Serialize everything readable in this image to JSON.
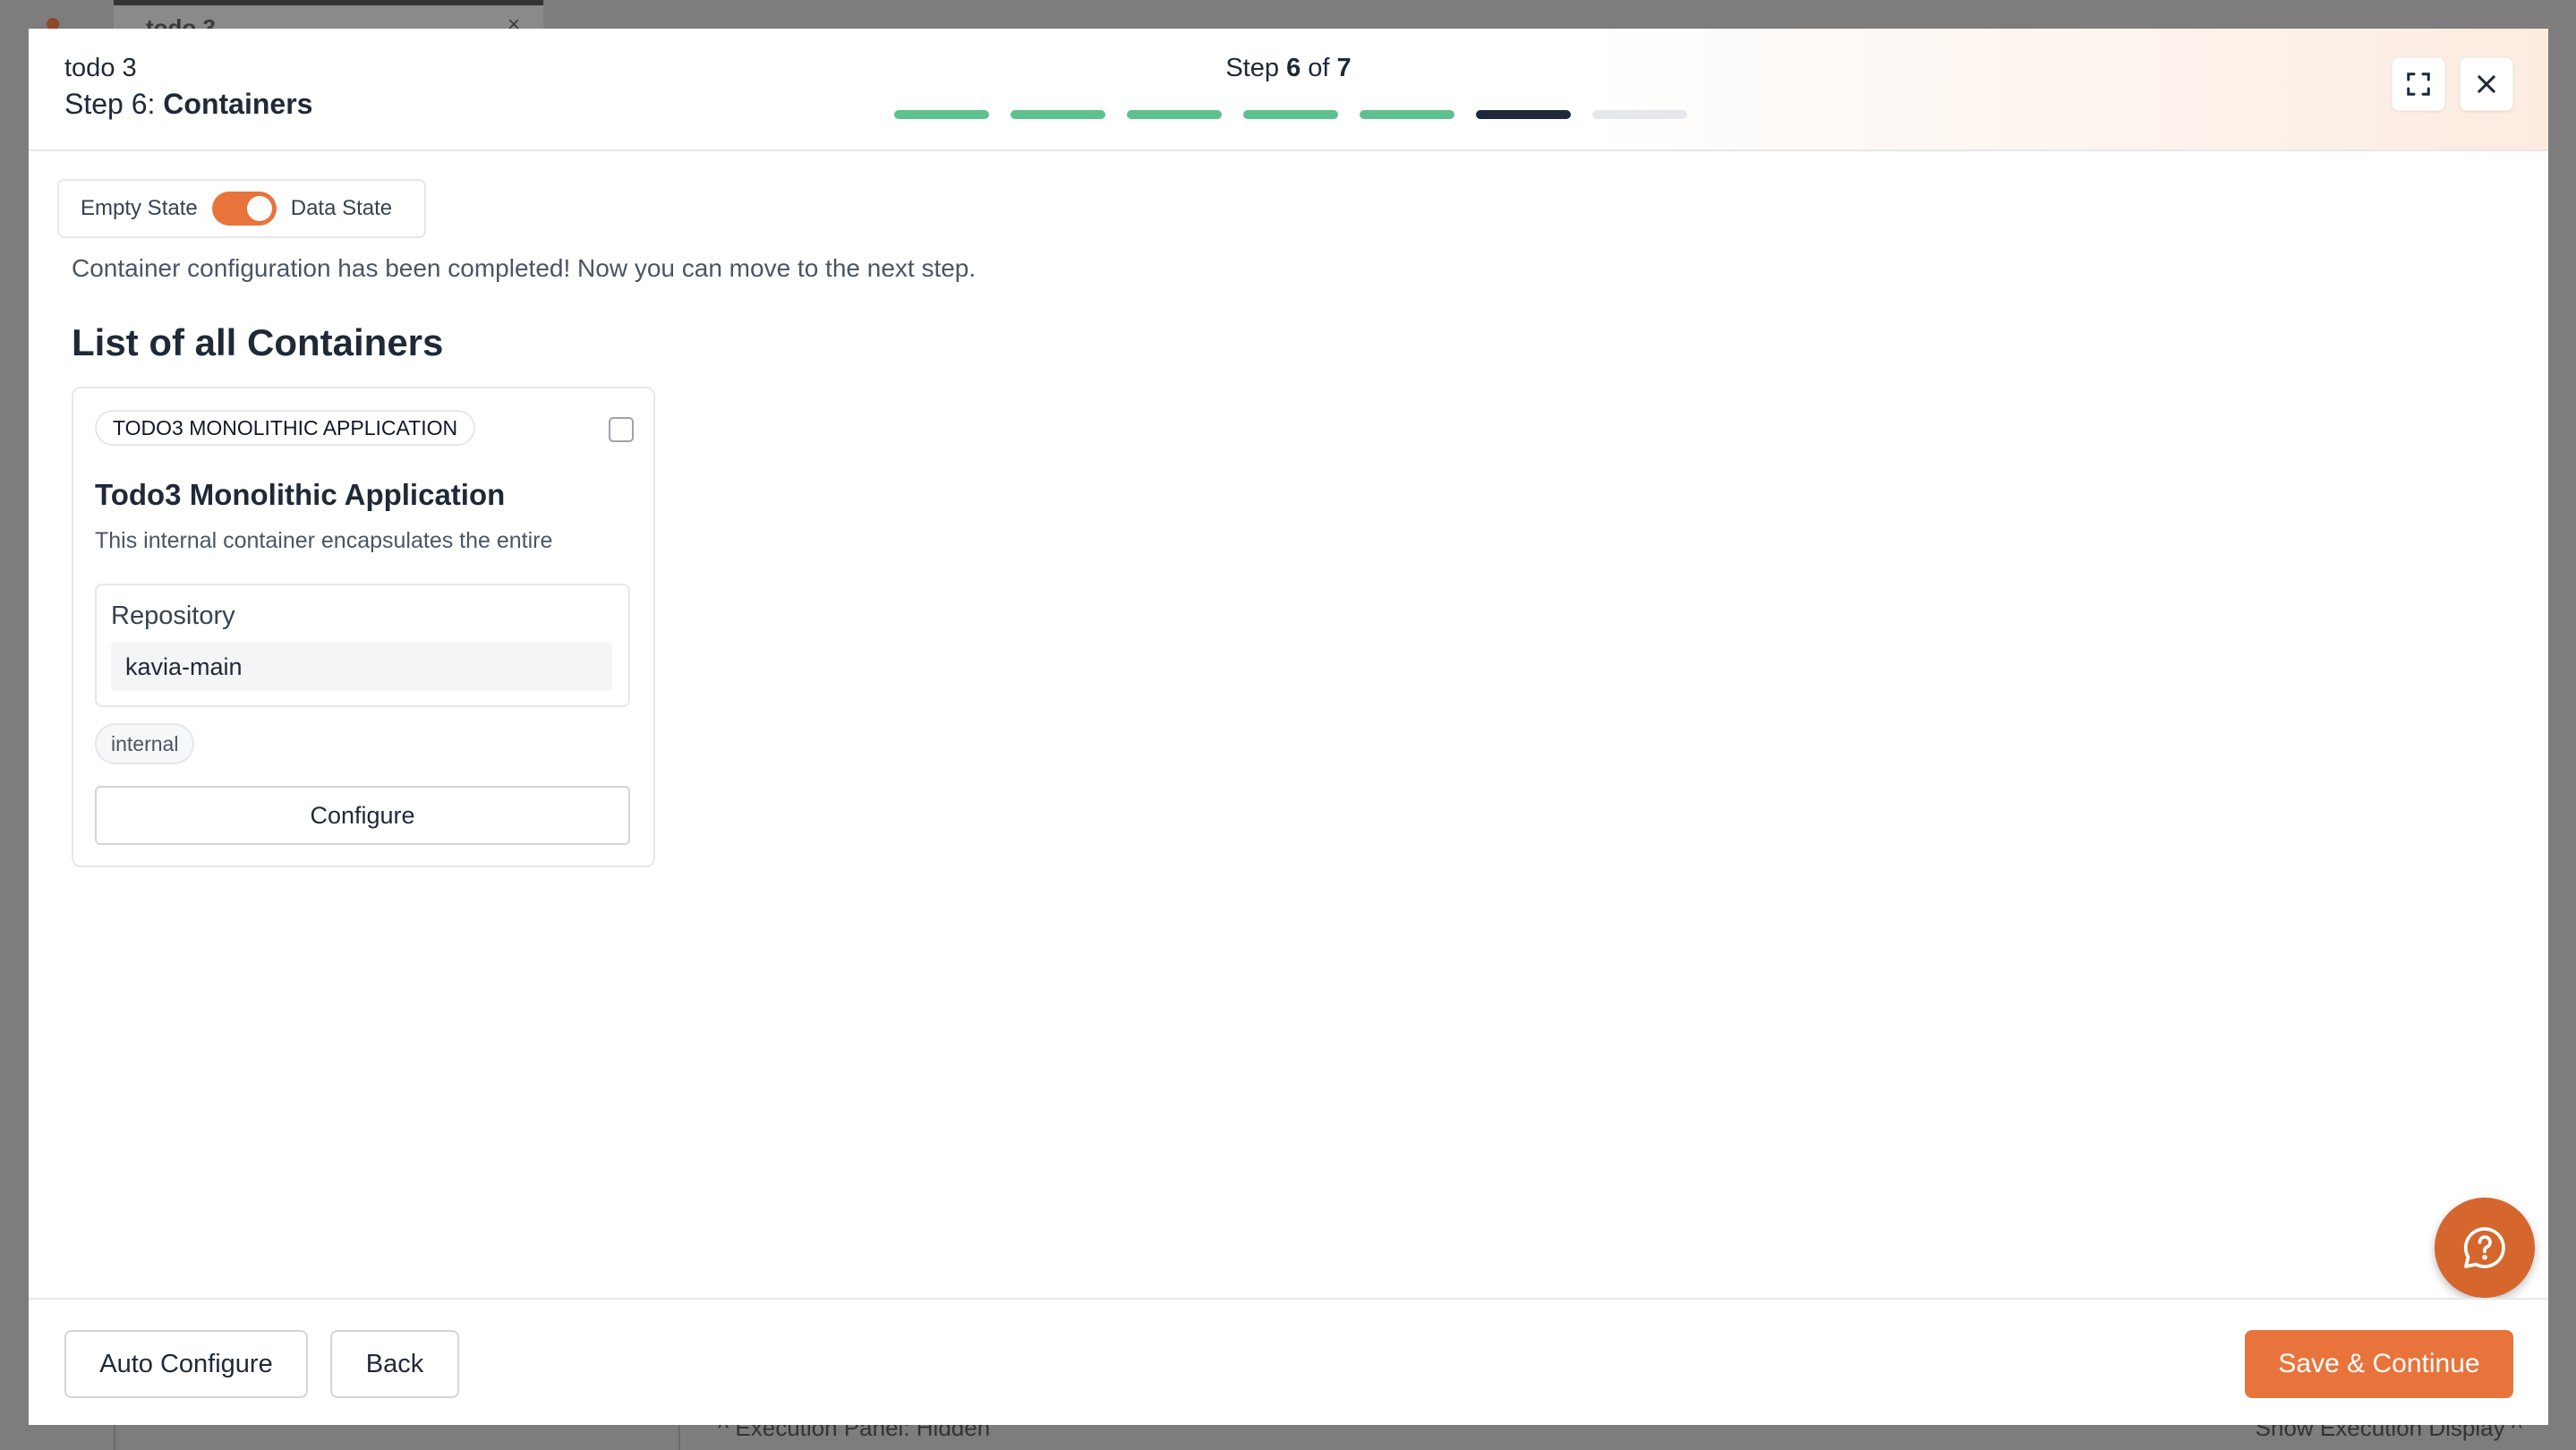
{
  "background": {
    "tab_label": "todo 3",
    "tab_close": "×",
    "execution_panel": "^  Execution Panel: Hidden",
    "show_execution": "Show Execution Display ^"
  },
  "header": {
    "project_name": "todo 3",
    "step_prefix": "Step 6: ",
    "step_name": "Containers",
    "counter_word": "Step",
    "current_step": "6",
    "of_word": "of",
    "total_steps": "7",
    "progress_colors": [
      "#5fbf8f",
      "#5fbf8f",
      "#5fbf8f",
      "#5fbf8f",
      "#5fbf8f",
      "#1e2a3b",
      "#e5e7eb"
    ],
    "expand_icon": "expand-icon",
    "close_icon": "close-icon"
  },
  "toggle": {
    "left_label": "Empty State",
    "right_label": "Data State",
    "on": true
  },
  "main": {
    "complete_message": "Container configuration has been completed! Now you can move to the next step.",
    "list_title": "List of all Containers"
  },
  "container_card": {
    "badge": "TODO3 MONOLITHIC APPLICATION",
    "title": "Todo3 Monolithic Application",
    "description": "This internal container encapsulates the entire",
    "repository_label": "Repository",
    "repository_value": "kavia-main",
    "tag": "internal",
    "configure_label": "Configure"
  },
  "footer": {
    "auto_configure_label": "Auto Configure",
    "back_label": "Back",
    "save_continue_label": "Save & Continue"
  },
  "colors": {
    "accent": "#e8743b",
    "progress_done": "#5fbf8f",
    "progress_current": "#1e2a3b",
    "progress_pending": "#e5e7eb"
  }
}
